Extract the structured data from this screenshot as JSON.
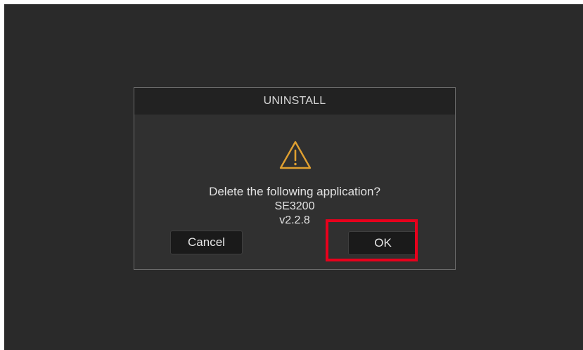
{
  "dialog": {
    "title": "UNINSTALL",
    "icon": "warning-icon",
    "message": "Delete the following application?",
    "app_name": "SE3200",
    "app_version": "v2.2.8",
    "cancel_label": "Cancel",
    "ok_label": "OK"
  },
  "colors": {
    "screen_bg": "#2a2a2a",
    "dialog_bg": "#303030",
    "header_bg": "#222222",
    "warning": "#e0a030",
    "highlight": "#e8001c"
  }
}
